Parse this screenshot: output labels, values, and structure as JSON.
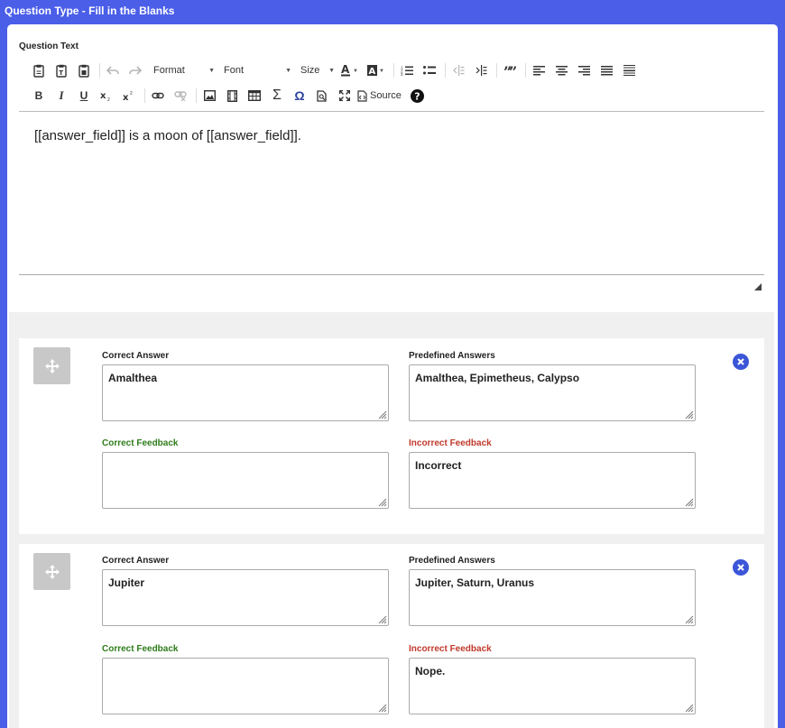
{
  "header": {
    "title": "Question Type - Fill in the Blanks"
  },
  "editor": {
    "label": "Question Text",
    "format_label": "Format",
    "font_label": "Font",
    "size_label": "Size",
    "source_label": "Source",
    "content": "[[answer_field]] is a moon of [[answer_field]]."
  },
  "answers": [
    {
      "correct_label": "Correct Answer",
      "correct_value": "Amalthea",
      "predefined_label": "Predefined Answers",
      "predefined_value": "Amalthea, Epimetheus, Calypso",
      "correct_feedback_label": "Correct Feedback",
      "correct_feedback_value": "",
      "incorrect_feedback_label": "Incorrect Feedback",
      "incorrect_feedback_value": "Incorrect"
    },
    {
      "correct_label": "Correct Answer",
      "correct_value": "Jupiter",
      "predefined_label": "Predefined Answers",
      "predefined_value": "Jupiter, Saturn, Uranus",
      "correct_feedback_label": "Correct Feedback",
      "correct_feedback_value": "",
      "incorrect_feedback_label": "Incorrect Feedback",
      "incorrect_feedback_value": "Nope."
    }
  ],
  "colors": {
    "header_bg": "#4a5ee8",
    "delete_button": "#3b56d8",
    "correct_feedback_label": "#2e7d1b",
    "incorrect_feedback_label": "#c0392b"
  }
}
